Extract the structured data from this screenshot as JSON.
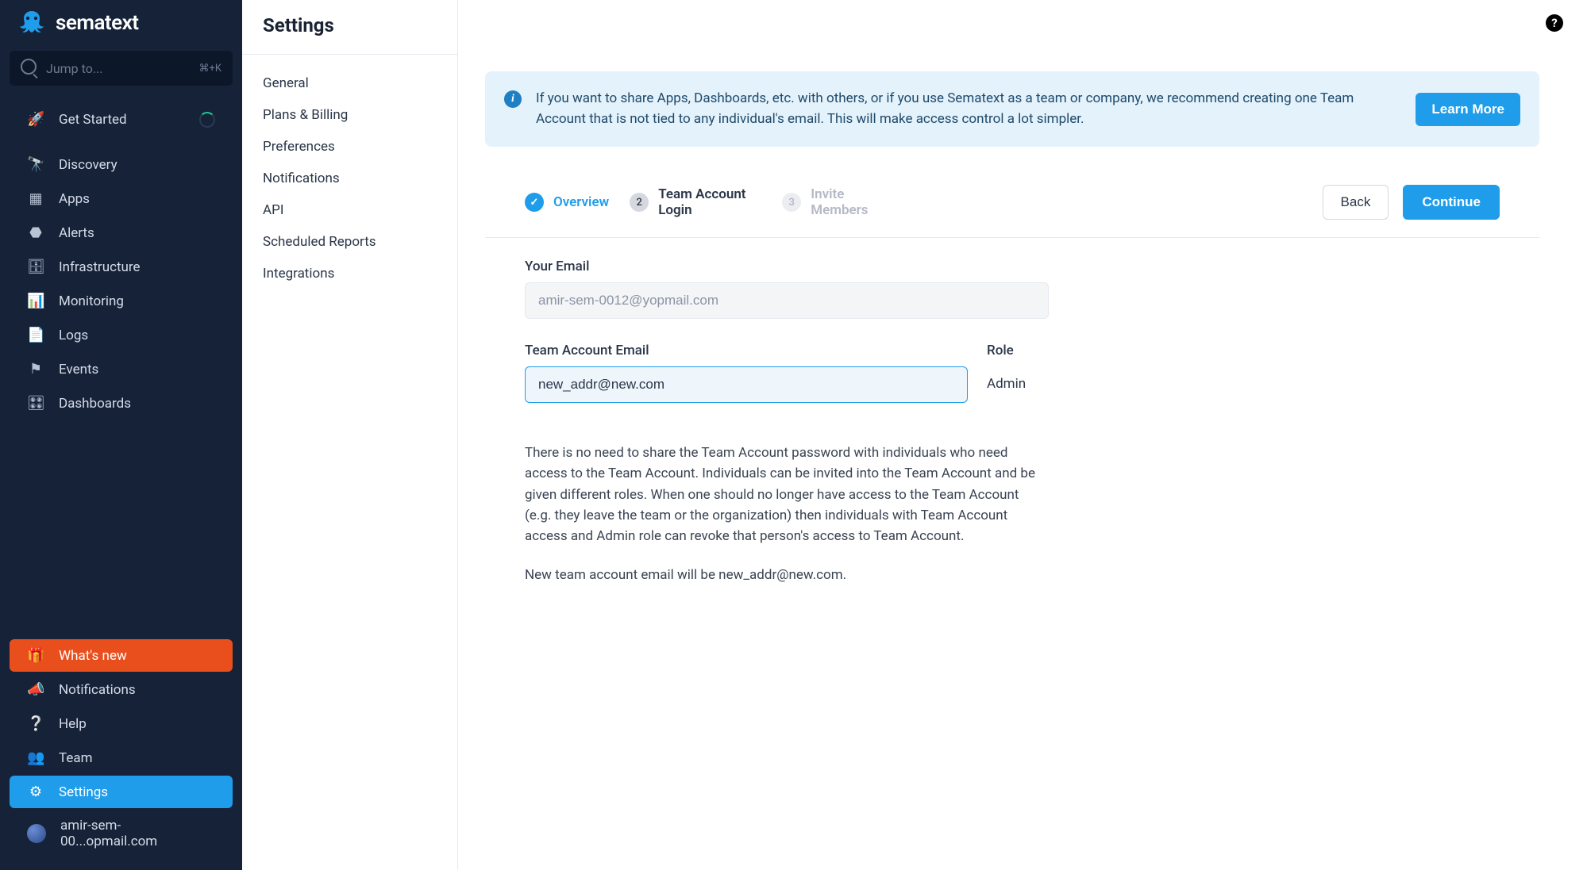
{
  "brand": "sematext",
  "jump": {
    "placeholder": "Jump to...",
    "shortcut": "⌘+K"
  },
  "nav": {
    "get_started": "Get Started",
    "items": [
      {
        "label": "Discovery"
      },
      {
        "label": "Apps"
      },
      {
        "label": "Alerts"
      },
      {
        "label": "Infrastructure"
      },
      {
        "label": "Monitoring"
      },
      {
        "label": "Logs"
      },
      {
        "label": "Events"
      },
      {
        "label": "Dashboards"
      }
    ],
    "bottom": {
      "whats_new": "What's new",
      "notifications": "Notifications",
      "help": "Help",
      "team": "Team",
      "settings": "Settings",
      "user": "amir-sem-00...opmail.com"
    }
  },
  "settings": {
    "title": "Settings",
    "items": [
      "General",
      "Plans & Billing",
      "Preferences",
      "Notifications",
      "API",
      "Scheduled Reports",
      "Integrations"
    ]
  },
  "banner": {
    "text": "If you want to share Apps, Dashboards, etc. with others, or if you use Sematext as a team or company, we recommend creating one Team Account that is not tied to any individual's email. This will make access control a lot simpler.",
    "cta": "Learn More"
  },
  "stepper": {
    "step1": "Overview",
    "step2": "Team Account Login",
    "step3": "Invite Members",
    "back": "Back",
    "continue": "Continue"
  },
  "form": {
    "your_email_label": "Your Email",
    "your_email_value": "amir-sem-0012@yopmail.com",
    "team_email_label": "Team Account Email",
    "team_email_value": "new_addr@new.com",
    "role_label": "Role",
    "role_value": "Admin"
  },
  "desc": {
    "p1": "There is no need to share the Team Account password with individuals who need access to the Team Account. Individuals can be invited into the Team Account and be given different roles. When one should no longer have access to the Team Account (e.g. they leave the team or the organization) then individuals with Team Account access and Admin role can revoke that person's access to Team Account.",
    "p2": "New team account email will be new_addr@new.com."
  }
}
